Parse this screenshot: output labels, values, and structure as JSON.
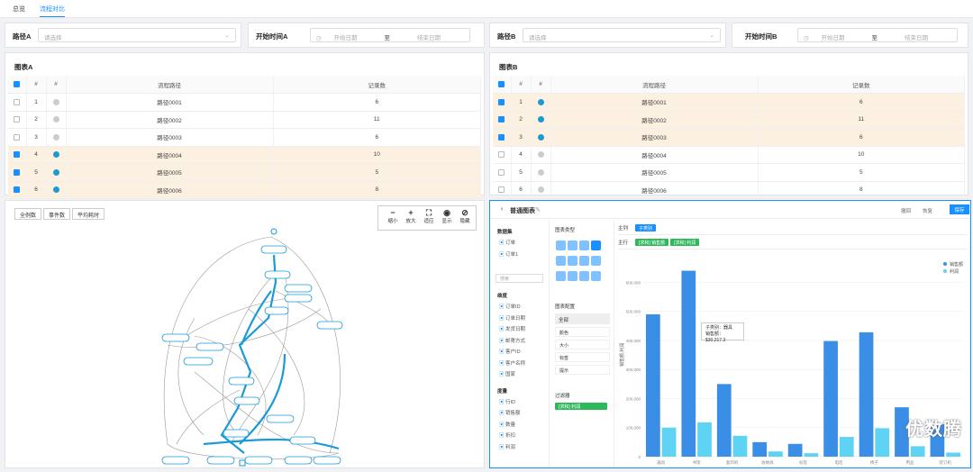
{
  "tabs": [
    {
      "label": "总览",
      "active": false
    },
    {
      "label": "流程对比",
      "active": true
    }
  ],
  "filters": {
    "pathA": {
      "label": "路径A",
      "placeholder": "请选择"
    },
    "timeA": {
      "label": "开始时间A",
      "start": "开始日期",
      "sep": "至",
      "end": "结束日期"
    },
    "pathB": {
      "label": "路径B",
      "placeholder": "请选择"
    },
    "timeB": {
      "label": "开始时间B",
      "start": "开始日期",
      "sep": "至",
      "end": "结束日期"
    }
  },
  "tableA": {
    "title": "图表A",
    "headers": [
      "#",
      "#",
      "流程路径",
      "记录数"
    ],
    "rows": [
      {
        "n": "1",
        "path": "路径0001",
        "count": "6",
        "checked": false
      },
      {
        "n": "2",
        "path": "路径0002",
        "count": "11",
        "checked": false
      },
      {
        "n": "3",
        "path": "路径0003",
        "count": "6",
        "checked": false
      },
      {
        "n": "4",
        "path": "路径0004",
        "count": "10",
        "checked": true
      },
      {
        "n": "5",
        "path": "路径0005",
        "count": "5",
        "checked": true
      },
      {
        "n": "6",
        "path": "路径0006",
        "count": "8",
        "checked": true
      }
    ]
  },
  "tableB": {
    "title": "图表B",
    "headers": [
      "#",
      "#",
      "流程路径",
      "记录数"
    ],
    "rows": [
      {
        "n": "1",
        "path": "路径0001",
        "count": "6",
        "checked": true
      },
      {
        "n": "2",
        "path": "路径0002",
        "count": "11",
        "checked": true
      },
      {
        "n": "3",
        "path": "路径0003",
        "count": "6",
        "checked": true
      },
      {
        "n": "4",
        "path": "路径0004",
        "count": "10",
        "checked": false
      },
      {
        "n": "5",
        "path": "路径0005",
        "count": "5",
        "checked": false
      },
      {
        "n": "6",
        "path": "路径0006",
        "count": "8",
        "checked": false
      }
    ]
  },
  "graph": {
    "buttons": [
      "全例数",
      "事件数",
      "平均耗时"
    ],
    "tools": [
      {
        "g": "−",
        "l": "缩小"
      },
      {
        "g": "+",
        "l": "放大"
      },
      {
        "g": "⛶",
        "l": "适应"
      },
      {
        "g": "◉",
        "l": "显示"
      },
      {
        "g": "⊘",
        "l": "隐藏"
      }
    ]
  },
  "chartEditor": {
    "title": "普通图表",
    "undo": "撤回",
    "redo": "恢复",
    "save": "保存",
    "datasetLabel": "数据集",
    "datasets": [
      "订单",
      "订单1"
    ],
    "searchPlaceholder": "搜索",
    "dimLabel": "维度",
    "dims": [
      "订单ID",
      "订单日期",
      "发货日期",
      "邮寄方式",
      "客户ID",
      "客户名称",
      "国家"
    ],
    "measLabel": "度量",
    "measures": [
      "行ID",
      "销售额",
      "数量",
      "折扣",
      "利润"
    ],
    "chartTypeLabel": "图表类型",
    "chartConfigLabel": "图表配置",
    "allLabel": "全部",
    "configItems": [
      "颜色",
      "大小",
      "标签",
      "提示"
    ],
    "filterLabel": "过滤器",
    "filterChip": "[求和] 利润",
    "colLabel": "主列",
    "colChip": "子类别",
    "rowLabel": "主行",
    "rowChips": [
      "[求和] 销售额",
      "[求和] 利润"
    ],
    "tooltip": {
      "line1": "子类别：器具",
      "line2": "销售额：$30,217.3"
    },
    "legend": [
      "销售额",
      "利润"
    ]
  },
  "chart_data": {
    "type": "bar",
    "categories": [
      "器具",
      "书架",
      "复印机",
      "收纳具",
      "标签",
      "电话",
      "椅子",
      "用品",
      "装订机"
    ],
    "series": [
      {
        "name": "销售额",
        "values": [
          490000,
          640000,
          250000,
          50000,
          44000,
          398000,
          428000,
          170000,
          112000
        ]
      },
      {
        "name": "利润",
        "values": [
          100000,
          118000,
          72000,
          18000,
          12000,
          68000,
          98000,
          36000,
          14000
        ]
      }
    ],
    "yTicks": [
      "0",
      "100,000",
      "200,000",
      "300,000",
      "400,000",
      "500,000",
      "600,000"
    ],
    "ylim": [
      0,
      620000
    ],
    "ylabel": "销售额,利润",
    "colors": {
      "销售额": "#3a8ee6",
      "利润": "#5ed3f3"
    }
  },
  "watermark": "优数腾"
}
